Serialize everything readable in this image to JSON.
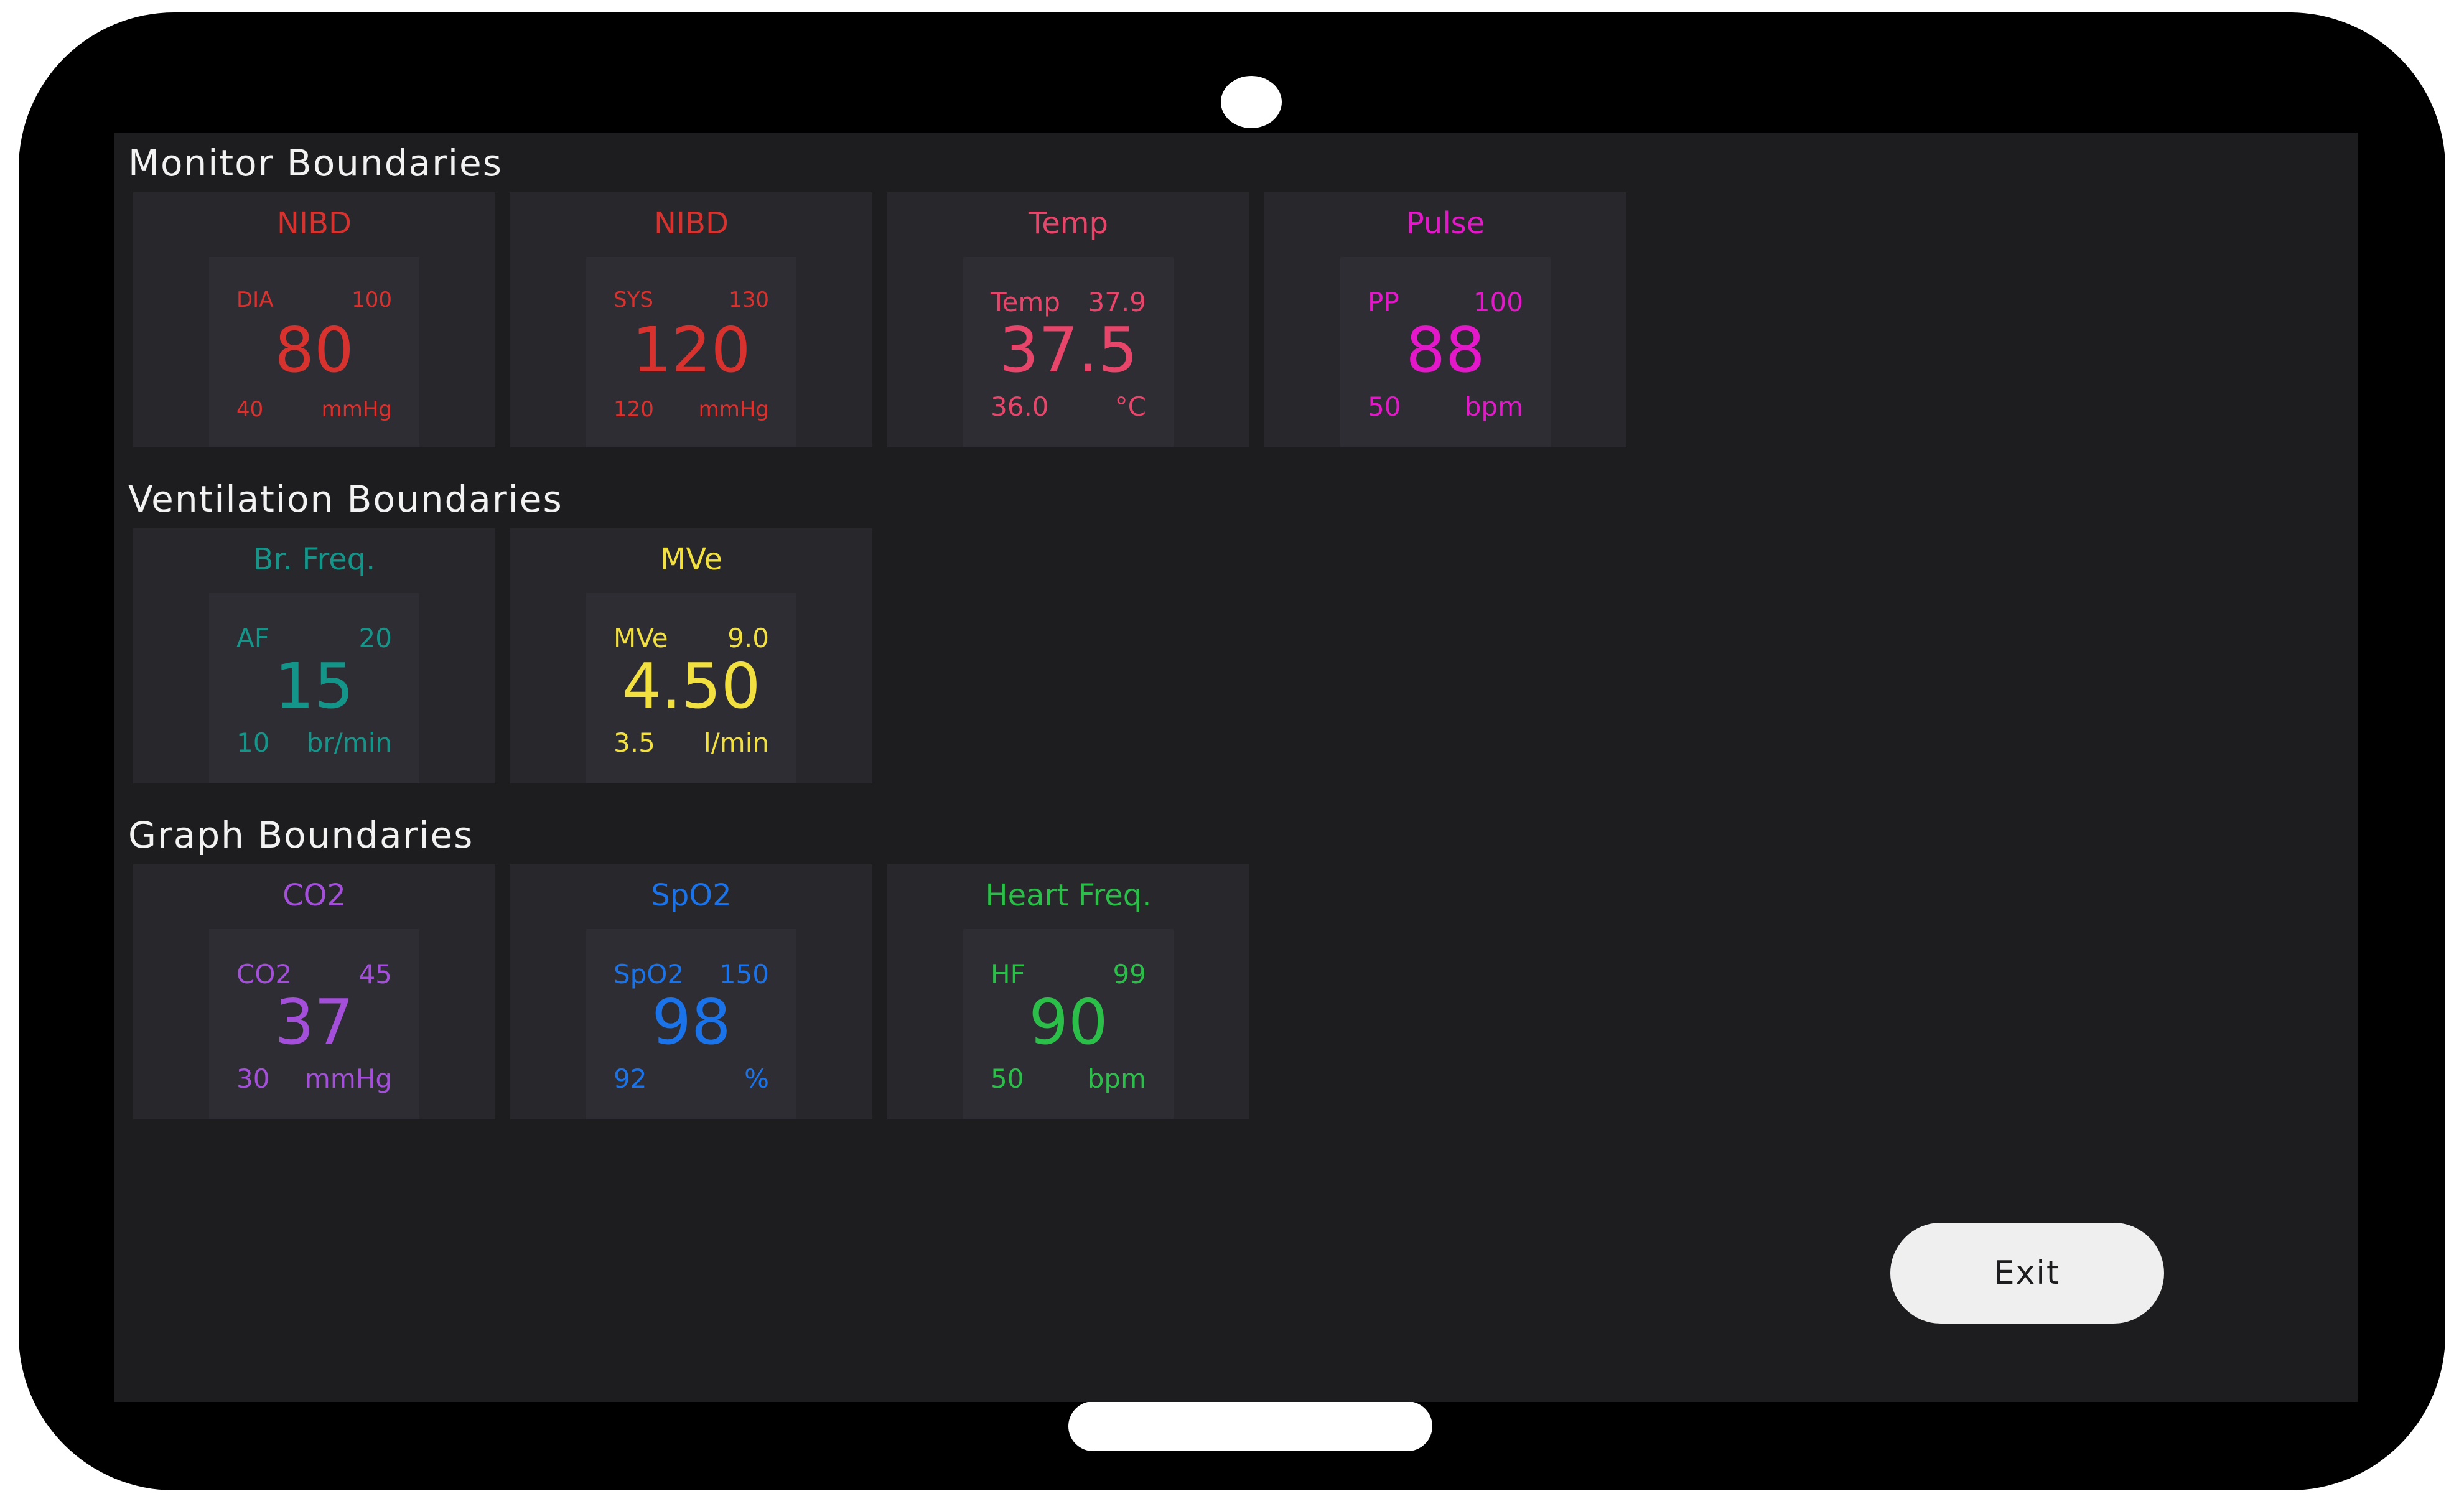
{
  "sections": {
    "monitor": "Monitor Boundaries",
    "ventilation": "Ventilation Boundaries",
    "graph": "Graph Boundaries"
  },
  "tiles": {
    "nibd_dia": {
      "title": "NIBD",
      "label": "DIA",
      "upper": "100",
      "value": "80",
      "lower": "40",
      "unit": "mmHg",
      "color": "#d8322f"
    },
    "nibd_sys": {
      "title": "NIBD",
      "label": "SYS",
      "upper": "130",
      "value": "120",
      "lower": "120",
      "unit": "mmHg",
      "color": "#d8322f"
    },
    "temp": {
      "title": "Temp",
      "label": "Temp",
      "upper": "37.9",
      "value": "37.5",
      "lower": "36.0",
      "unit": "°C",
      "color": "#e8456a"
    },
    "pulse": {
      "title": "Pulse",
      "label": "PP",
      "upper": "100",
      "value": "88",
      "lower": "50",
      "unit": "bpm",
      "color": "#e318c8"
    },
    "br_freq": {
      "title": "Br. Freq.",
      "label": "AF",
      "upper": "20",
      "value": "15",
      "lower": "10",
      "unit": "br/min",
      "color": "#14958a"
    },
    "mve": {
      "title": "MVe",
      "label": "MVe",
      "upper": "9.0",
      "value": "4.50",
      "lower": "3.5",
      "unit": "l/min",
      "color": "#f2e040"
    },
    "co2": {
      "title": "CO2",
      "label": "CO2",
      "upper": "45",
      "value": "37",
      "lower": "30",
      "unit": "mmHg",
      "color": "#a44fd9"
    },
    "spo2": {
      "title": "SpO2",
      "label": "SpO2",
      "upper": "150",
      "value": "98",
      "lower": "92",
      "unit": "%",
      "color": "#1a73e8"
    },
    "heart_freq": {
      "title": "Heart Freq.",
      "label": "HF",
      "upper": "99",
      "value": "90",
      "lower": "50",
      "unit": "bpm",
      "color": "#2bbf4a"
    }
  },
  "exit_label": "Exit"
}
